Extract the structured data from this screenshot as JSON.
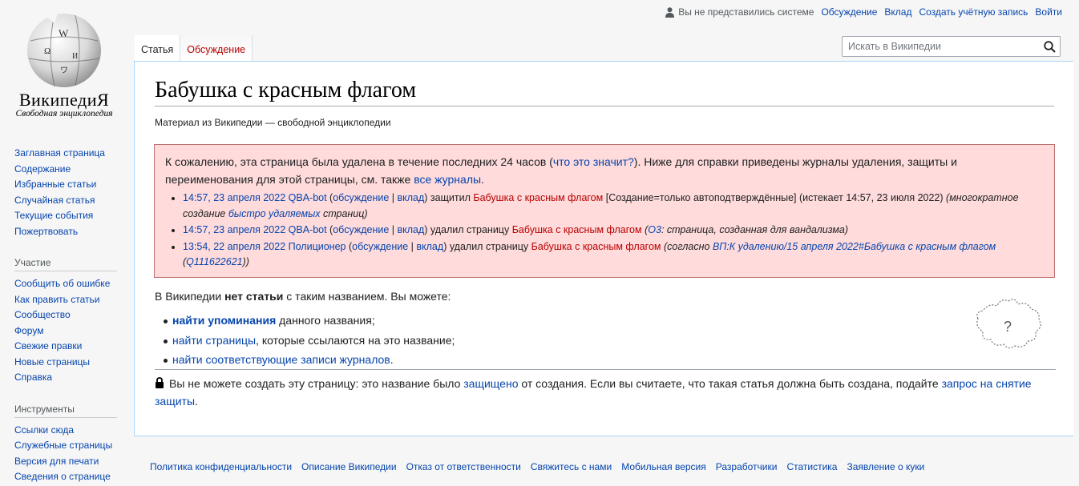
{
  "personal": {
    "not_logged_in": "Вы не представились системе",
    "talk": "Обсуждение",
    "login": "Вклад",
    "create_account": "Создать учётную запись",
    "logout": "Войти"
  },
  "logo": {
    "title": "ВикипедиЯ",
    "subtitle": "Свободная энциклопедия"
  },
  "sidebar": {
    "nav": [
      "Заглавная страница",
      "Содержание",
      "Избранные статьи",
      "Случайная статья",
      "Текущие события",
      "Пожертвовать"
    ],
    "participation_head": "Участие",
    "participation": [
      "Сообщить об ошибке",
      "Как править статьи",
      "Сообщество",
      "Форум",
      "Свежие правки",
      "Новые страницы",
      "Справка"
    ],
    "tools_head": "Инструменты",
    "tools": [
      "Ссылки сюда",
      "Служебные страницы",
      "Версия для печати",
      "Сведения о странице"
    ]
  },
  "tabs": {
    "article": "Статья",
    "talk": "Обсуждение"
  },
  "search": {
    "placeholder": "Искать в Википедии"
  },
  "page": {
    "title": "Бабушка с красным флагом",
    "tagline": "Материал из Википедии — свободной энциклопедии"
  },
  "notice": {
    "p1": "К сожалению, эта страница была удалена в течение последних 24 часов (",
    "p1_link": "что это значит?",
    "p2": "). Ниже для справки приведены журналы удаления, защиты и переименования для этой страницы, см. также ",
    "p2_link": "все журналы",
    "p3": ".",
    "entries": [
      {
        "time": "14:57, 23 апреля 2022",
        "user": "QBA-bot",
        "talk": "обсуждение",
        "contribs": "вклад",
        "action": "защитил",
        "page": "Бабушка с красным флагом",
        "detail": "[Создание=только автоподтверждённые] (истекает 14:57, 23 июля 2022)",
        "comment_a": "(многократное создание ",
        "comment_link": "быстро удаляемых",
        "comment_b": " страниц)"
      },
      {
        "time": "14:57, 23 апреля 2022",
        "user": "QBA-bot",
        "talk": "обсуждение",
        "contribs": "вклад",
        "action": "удалил страницу",
        "page": "Бабушка с красным флагом",
        "comment_link": "О3",
        "comment_b": ": страница, созданная для вандализма)"
      },
      {
        "time": "13:54, 22 апреля 2022",
        "user": "Полиционер",
        "talk": "обсуждение",
        "contribs": "вклад",
        "action": "удалил страницу",
        "page": "Бабушка с красным флагом",
        "comment_a": "(согласно ",
        "comment_link": "ВП:К удалению/15 апреля 2022#Бабушка с красным флагом",
        "comment_link2": "Q111622621",
        "comment_b": "))"
      }
    ]
  },
  "nothing": {
    "a": "В Википедии ",
    "b": "нет статьи",
    "c": " с таким названием. Вы можете:"
  },
  "options": [
    {
      "link": "найти упоминания",
      "rest": " данного названия;"
    },
    {
      "link": "найти страницы",
      "rest": ", которые ссылаются на это название;"
    },
    {
      "link": "найти соответствующие записи журналов",
      "rest": "."
    }
  ],
  "protect": {
    "a": "Вы не можете создать эту страницу: это название было ",
    "link1": "защищено",
    "b": " от создания. Если вы считаете, что такая статья должна быть создана, подайте ",
    "link2": "запрос на снятие защиты",
    "c": "."
  },
  "footer": [
    "Политика конфиденциальности",
    "Описание Википедии",
    "Отказ от ответственности",
    "Свяжитесь с нами",
    "Мобильная версия",
    "Разработчики",
    "Статистика",
    "Заявление о куки"
  ]
}
